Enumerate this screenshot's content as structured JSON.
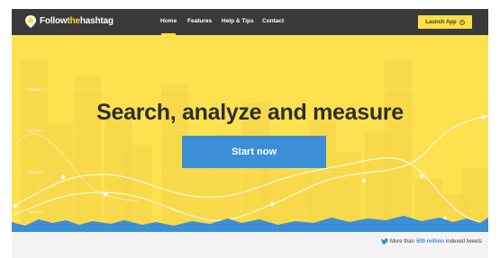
{
  "header": {
    "logo_part1": "Follow",
    "logo_part2": "the",
    "logo_part3": "hashtag",
    "nav": [
      "Home",
      "Features",
      "Help & Tips",
      "Contact"
    ],
    "launch_label": "Launch App"
  },
  "hero": {
    "headline": "Search, analyze and measure",
    "cta_label": "Start now",
    "bg_chart_y_labels": [
      "600,000",
      "450,000",
      "300,000",
      "150,000"
    ]
  },
  "footer_stat": {
    "prefix": "More than",
    "count": "500 million",
    "suffix": "indexed tweets"
  },
  "colors": {
    "accent_yellow": "#fde14f",
    "nav_bg": "#3a3a3a",
    "cta_blue": "#3b8fd6"
  }
}
